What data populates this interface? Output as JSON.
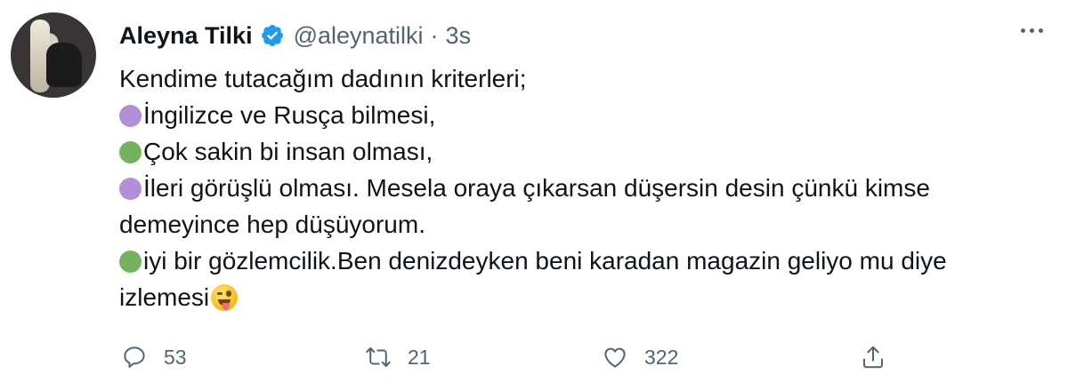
{
  "author": {
    "name": "Aleyna Tilki",
    "handle": "@aleynatilki",
    "separator": "·",
    "time": "3s",
    "verified": true
  },
  "tweet": {
    "lines": [
      {
        "bullet": null,
        "text": "Kendime tutacağım dadının kriterleri;"
      },
      {
        "bullet": "purple-circle",
        "text": "İngilizce ve Rusça bilmesi,"
      },
      {
        "bullet": "green-circle",
        "text": "Çok sakin bi insan olması,"
      },
      {
        "bullet": "purple-circle",
        "text": "İleri görüşlü olması. Mesela oraya çıkarsan düşersin desin çünkü kimse"
      },
      {
        "bullet": null,
        "text": "demeyince hep düşüyorum."
      },
      {
        "bullet": "green-circle",
        "text": "iyi bir gözlemcilik.Ben denizdeyken beni karadan magazin geliyo mu diye"
      },
      {
        "bullet": null,
        "text": "izlemesi",
        "trailing_emoji": "winking-face-with-tongue"
      }
    ]
  },
  "actions": {
    "reply": {
      "icon": "reply-icon",
      "count": "53"
    },
    "retweet": {
      "icon": "retweet-icon",
      "count": "21"
    },
    "like": {
      "icon": "heart-icon",
      "count": "322"
    },
    "share": {
      "icon": "share-icon"
    }
  },
  "colors": {
    "verified_blue": "#1d9bf0",
    "bullet_purple": "#b18fd8",
    "bullet_green": "#74b25f",
    "secondary_text": "#536471",
    "primary_text": "#0f1419"
  }
}
